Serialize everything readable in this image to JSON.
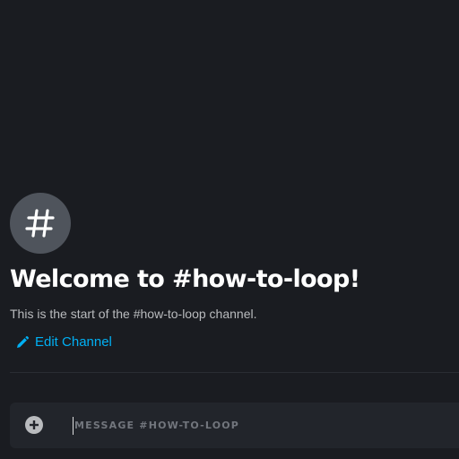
{
  "channel": {
    "icon": "hashtag-icon",
    "welcome_title": "Welcome to #how-to-loop!",
    "description": "This is the start of the #how-to-loop channel.",
    "edit_label": "Edit Channel"
  },
  "composer": {
    "attach_icon": "plus-circle-icon",
    "placeholder": "MESSAGE #HOW-TO-LOOP"
  },
  "colors": {
    "background": "#1a1c21",
    "badge": "#4f545c",
    "title": "#ffffff",
    "description": "#b9bbbe",
    "link": "#00b0f4",
    "composer": "#22252b",
    "placeholder": "#72767d"
  }
}
